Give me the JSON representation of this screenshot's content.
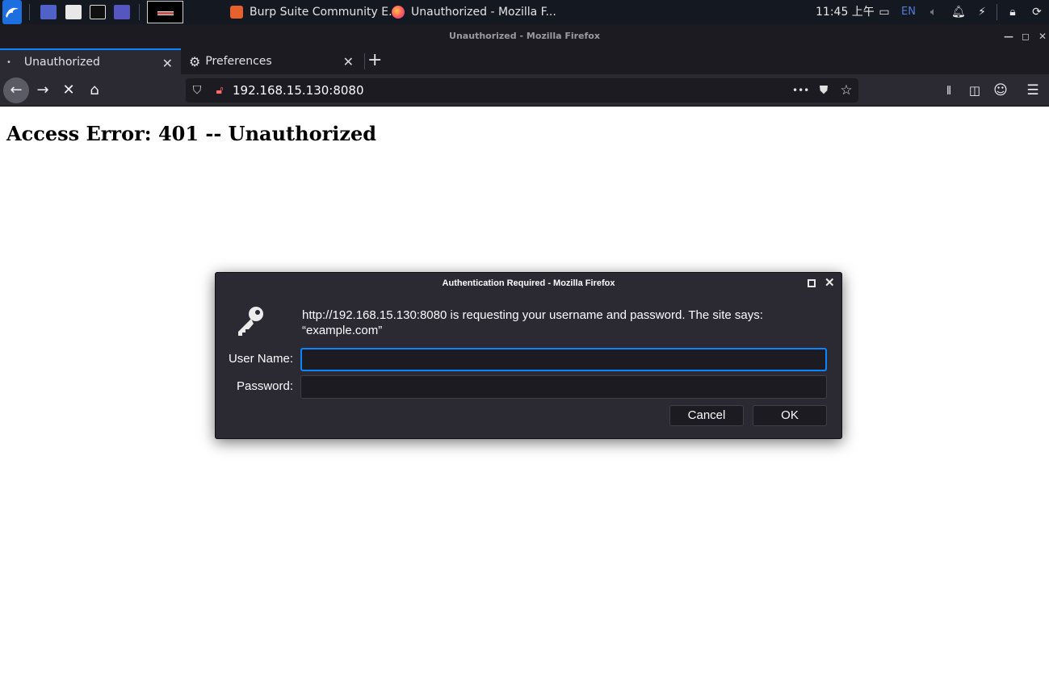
{
  "taskbar": {
    "tasks": [
      {
        "label": "Burp Suite Community E..."
      },
      {
        "label": "Unauthorized - Mozilla F..."
      }
    ],
    "clock": "11:45 上午",
    "language": "EN"
  },
  "window": {
    "title": "Unauthorized - Mozilla Firefox"
  },
  "tabs": [
    {
      "label": "Unauthorized",
      "active": true
    },
    {
      "label": "Preferences",
      "active": false
    }
  ],
  "navbar": {
    "url": "192.168.15.130:8080",
    "page_actions_label": "•••"
  },
  "page": {
    "heading": "Access Error: 401 -- Unauthorized"
  },
  "auth_dialog": {
    "title": "Authentication Required - Mozilla Firefox",
    "message_line1": "http://192.168.15.130:8080 is requesting your username and password. The site says:",
    "message_line2": "“example.com”",
    "username_label": "User Name:",
    "username_value": "",
    "password_label": "Password:",
    "password_value": "",
    "cancel_label": "Cancel",
    "ok_label": "OK"
  },
  "colors": {
    "accent": "#0a84ff",
    "toolbar": "#2b2a33",
    "titlebar": "#1c1b22"
  }
}
